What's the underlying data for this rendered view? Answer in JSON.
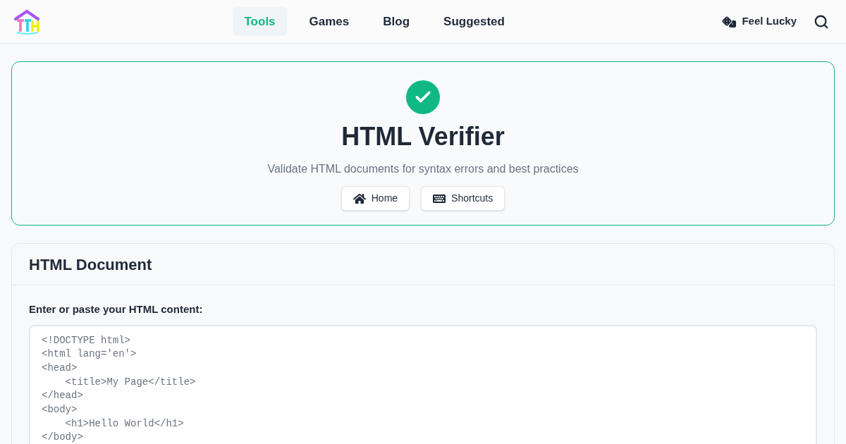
{
  "nav": {
    "items": [
      {
        "label": "Tools",
        "selected": true
      },
      {
        "label": "Games",
        "selected": false
      },
      {
        "label": "Blog",
        "selected": false
      },
      {
        "label": "Suggested",
        "selected": false
      }
    ],
    "lucky": "Feel Lucky"
  },
  "hero": {
    "title": "HTML Verifier",
    "subtitle": "Validate HTML documents for syntax errors and best practices",
    "buttons": [
      {
        "kind": "home",
        "label": "Home"
      },
      {
        "kind": "shortcuts",
        "label": "Shortcuts"
      }
    ]
  },
  "document": {
    "title": "HTML Document",
    "label": "Enter or paste your HTML content:",
    "placeholder": "<!DOCTYPE html>\n<html lang='en'>\n<head>\n    <title>My Page</title>\n</head>\n<body>\n    <h1>Hello World</h1>\n</body>"
  }
}
